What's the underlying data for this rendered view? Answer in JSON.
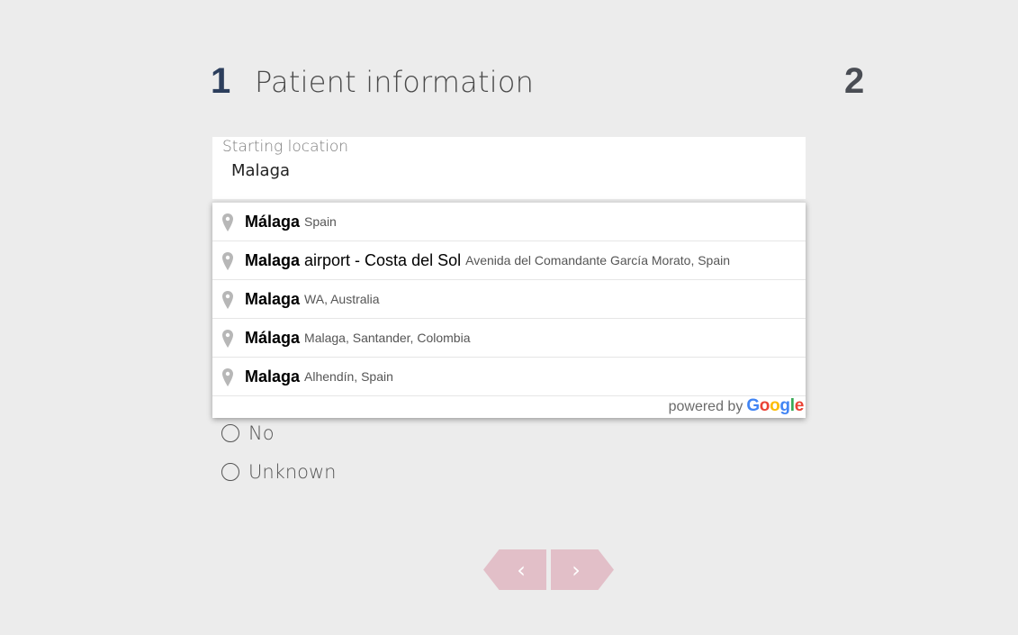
{
  "header": {
    "step_current": "1",
    "title": "Patient information",
    "step_next": "2"
  },
  "location_field": {
    "label": "Starting location",
    "value": "Malaga"
  },
  "suggestions": [
    {
      "match": "Málaga",
      "rest": "",
      "secondary": "Spain"
    },
    {
      "match": "Malaga",
      "rest": " airport - Costa del Sol",
      "secondary": "Avenida del Comandante García Morato, Spain"
    },
    {
      "match": "Malaga",
      "rest": "",
      "secondary": "WA, Australia"
    },
    {
      "match": "Málaga",
      "rest": "",
      "secondary": "Malaga, Santander, Colombia"
    },
    {
      "match": "Malaga",
      "rest": "",
      "secondary": "Alhendín, Spain"
    }
  ],
  "attribution": {
    "powered_by": "powered by",
    "brand": "Google",
    "brand_colors": [
      "#4285F4",
      "#EA4335",
      "#FBBC05",
      "#4285F4",
      "#34A853",
      "#EA4335"
    ]
  },
  "options": [
    {
      "label": "No"
    },
    {
      "label": "Unknown"
    }
  ],
  "nav": {
    "prev_symbol": "‹",
    "next_symbol": "›",
    "button_color": "#e2bfc8"
  }
}
